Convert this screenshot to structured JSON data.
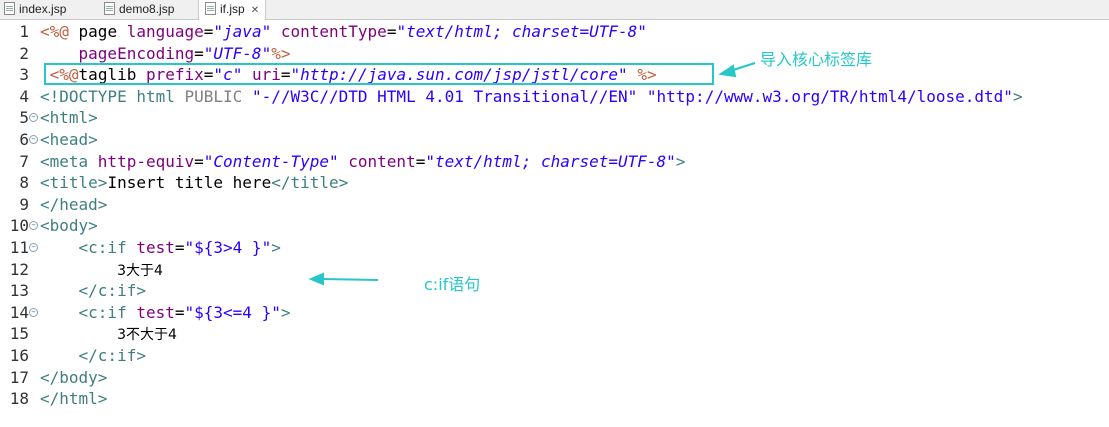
{
  "tabs": [
    {
      "label": "index.jsp"
    },
    {
      "label": "demo8.jsp"
    },
    {
      "label": "if.jsp",
      "active": true,
      "close": "✕"
    }
  ],
  "lines": [
    {
      "n": "1",
      "fold": false
    },
    {
      "n": "2",
      "fold": false
    },
    {
      "n": "3",
      "fold": false
    },
    {
      "n": "4",
      "fold": false
    },
    {
      "n": "5",
      "fold": true
    },
    {
      "n": "6",
      "fold": true
    },
    {
      "n": "7",
      "fold": false
    },
    {
      "n": "8",
      "fold": false
    },
    {
      "n": "9",
      "fold": false
    },
    {
      "n": "10",
      "fold": true
    },
    {
      "n": "11",
      "fold": true
    },
    {
      "n": "12",
      "fold": false
    },
    {
      "n": "13",
      "fold": false
    },
    {
      "n": "14",
      "fold": true
    },
    {
      "n": "15",
      "fold": false
    },
    {
      "n": "16",
      "fold": false
    },
    {
      "n": "17",
      "fold": false
    },
    {
      "n": "18",
      "fold": false
    }
  ],
  "code": {
    "l1": [
      "<%@",
      " page ",
      "language",
      "=",
      "\"java\"",
      " ",
      "contentType",
      "=",
      "\"text/html; charset=UTF-8\""
    ],
    "l2": [
      "    ",
      "pageEncoding",
      "=",
      "\"UTF-8\"",
      "%>"
    ],
    "l3": [
      " ",
      "<%@",
      "taglib ",
      "prefix",
      "=",
      "\"c\"",
      " ",
      "uri",
      "=",
      "\"http://java.sun.com/jsp/jstl/core\"",
      " ",
      "%>"
    ],
    "l4": [
      "<!DOCTYPE html ",
      "PUBLIC",
      " ",
      "\"-//W3C//DTD HTML 4.01 Transitional//EN\"",
      " ",
      "\"http://www.w3.org/TR/html4/loose.dtd\"",
      ">"
    ],
    "l5": [
      "<html>"
    ],
    "l6": [
      "<head>"
    ],
    "l7": [
      "<meta ",
      "http-equiv",
      "=",
      "\"Content-Type\"",
      " ",
      "content",
      "=",
      "\"text/html; charset=UTF-8\"",
      ">"
    ],
    "l8": [
      "<title>",
      "Insert title here",
      "</title>"
    ],
    "l9": [
      "</head>"
    ],
    "l10": [
      "<body>"
    ],
    "l11": [
      "    ",
      "<c:if ",
      "test",
      "=",
      "\"${3>4 }\"",
      ">"
    ],
    "l12": [
      "        ",
      "3大于4"
    ],
    "l13": [
      "    ",
      "</c:if>"
    ],
    "l14": [
      "    ",
      "<c:if ",
      "test",
      "=",
      "\"${3<=4 }\"",
      ">"
    ],
    "l15": [
      "        ",
      "3不大于4"
    ],
    "l16": [
      "    ",
      "</c:if>"
    ],
    "l17": [
      "</body>"
    ],
    "l18": [
      "</html>"
    ]
  },
  "annotations": {
    "taglib_note": "导入核心标签库",
    "if_note": "c:if语句",
    "color": "#27c7c9"
  }
}
